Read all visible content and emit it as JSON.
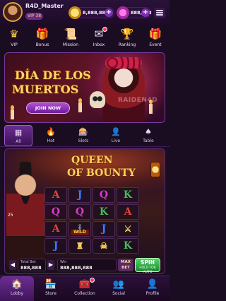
{
  "header": {
    "username": "R4D_Master",
    "vip_level": "VIP 38",
    "coins": "8,888,888",
    "gems": "888,888"
  },
  "icon_row": [
    {
      "label": "VIP",
      "icon": "vip-crown-icon",
      "glyph": "♛",
      "color": "#ffcf4a"
    },
    {
      "label": "Bonus",
      "icon": "gift-icon",
      "glyph": "🎁",
      "color": "#ff6bd1"
    },
    {
      "label": "Mission",
      "icon": "scroll-icon",
      "glyph": "📜",
      "color": "#ffd77a"
    },
    {
      "label": "Inbox",
      "icon": "mail-icon",
      "glyph": "✉",
      "color": "#f0e0ff",
      "badge": true
    },
    {
      "label": "Ranking",
      "icon": "trophy-icon",
      "glyph": "🏆",
      "color": "#ffcf4a"
    },
    {
      "label": "Event",
      "icon": "present-icon",
      "glyph": "🎁",
      "color": "#d94cff"
    }
  ],
  "banner": {
    "title_line1": "DÍA DE LOS",
    "title_line2": "MUERTOS",
    "button": "JOIN NOW",
    "watermark": "RAIDEN4D"
  },
  "categories": [
    {
      "label": "All",
      "icon": "grid-icon",
      "glyph": "▦",
      "active": true
    },
    {
      "label": "Hot",
      "icon": "flame-icon",
      "glyph": "🔥",
      "active": false
    },
    {
      "label": "Slots",
      "icon": "slot-machine-icon",
      "glyph": "🎰",
      "active": false
    },
    {
      "label": "Live",
      "icon": "live-dealer-icon",
      "glyph": "👤",
      "active": false
    },
    {
      "label": "Table",
      "icon": "spade-icon",
      "glyph": "♠",
      "active": false
    }
  ],
  "game": {
    "title_line1": "QUEEN",
    "title_line2": "OF BOUNTY",
    "bet_multiplier": "25",
    "reels": [
      [
        "A",
        "J",
        "Q",
        "K"
      ],
      [
        "Q",
        "Q",
        "K",
        "A"
      ],
      [
        "A",
        "⚓",
        "J",
        "⚔"
      ],
      [
        "J",
        "♜",
        "☠",
        "K"
      ]
    ],
    "wild_label": "WILD",
    "total_bet_label": "Total Bet",
    "total_bet": "888,888",
    "win_label": "Win",
    "win": "888,888,888",
    "max_bet": "MAX BET",
    "spin": "SPIN",
    "spin_sub": "HOLD FOR AUTO"
  },
  "bottom_nav": [
    {
      "label": "Lobby",
      "icon": "house-icon",
      "glyph": "🏠",
      "active": true
    },
    {
      "label": "Store",
      "icon": "store-icon",
      "glyph": "🏪",
      "active": false
    },
    {
      "label": "Collection",
      "icon": "treasure-chest-icon",
      "glyph": "🧰",
      "active": false,
      "badge": true
    },
    {
      "label": "Social",
      "icon": "people-icon",
      "glyph": "👥",
      "active": false
    },
    {
      "label": "Profile",
      "icon": "profile-icon",
      "glyph": "👤",
      "active": false
    }
  ]
}
